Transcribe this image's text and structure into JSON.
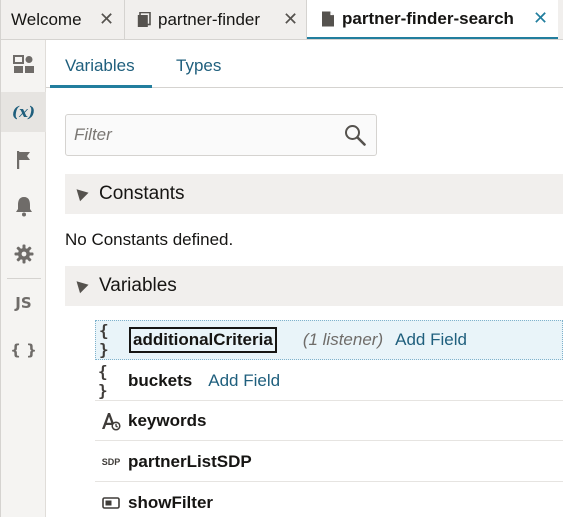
{
  "tabs": [
    {
      "label": "Welcome",
      "icon": "none",
      "active": false
    },
    {
      "label": "partner-finder",
      "icon": "copy-icon",
      "active": false
    },
    {
      "label": "partner-finder-search",
      "icon": "file-icon",
      "active": true
    }
  ],
  "close_glyph": "✕",
  "rail": {
    "variables_text": "(x)",
    "js_text": "JS",
    "json_text": "{ }"
  },
  "subtabs": [
    {
      "label": "Variables"
    },
    {
      "label": "Types"
    }
  ],
  "filter": {
    "placeholder": "Filter",
    "value": ""
  },
  "constants": {
    "title": "Constants",
    "empty": "No Constants defined."
  },
  "variables": {
    "title": "Variables",
    "items": [
      {
        "icon_text": "{ }",
        "name": "additionalCriteria",
        "meta": "(1 listener)",
        "action": "Add Field"
      },
      {
        "icon_text": "{ }",
        "name": "buckets",
        "meta": "",
        "action": "Add Field"
      },
      {
        "icon_text": "",
        "name": "keywords",
        "meta": "",
        "action": ""
      },
      {
        "icon_text": "SDP",
        "name": "partnerListSDP",
        "meta": "",
        "action": ""
      },
      {
        "icon_text": "",
        "name": "showFilter",
        "meta": "",
        "action": ""
      }
    ]
  },
  "colors": {
    "accent": "#227e9e",
    "link": "#1f5f7d"
  }
}
